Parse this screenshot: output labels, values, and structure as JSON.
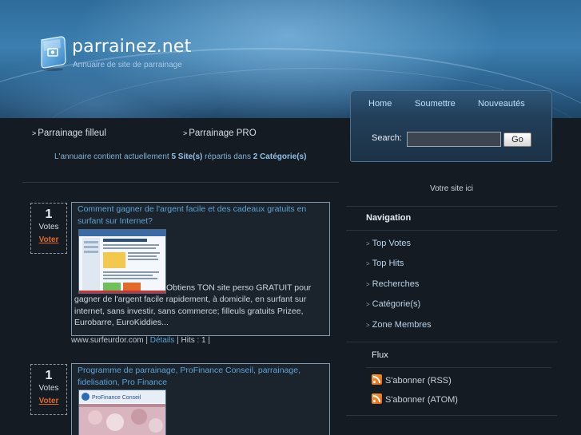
{
  "header": {
    "title": "parrainez.net",
    "subtitle": "Annuaire de site de parrainage"
  },
  "topnav": {
    "items": [
      "Home",
      "Soumettre",
      "Nouveautés"
    ],
    "search_label": "Search:",
    "search_value": "",
    "go_label": "Go"
  },
  "categories": [
    {
      "label": "Parrainage filleul"
    },
    {
      "label": "Parrainage PRO"
    }
  ],
  "count_line": {
    "prefix": "L'annuaire contient actuellement",
    "sites": "5 Site(s)",
    "middle": "répartis dans",
    "cats": "2 Catégorie(s)"
  },
  "listings": [
    {
      "votes": "1",
      "votes_label": "Votes",
      "vote_link": "Voter",
      "title": "Comment gagner de l'argent facile et des cadeaux gratuits en surfant sur Internet?",
      "desc_head": "Obtiens TON site perso GRATUIT pour",
      "desc_rest": "gagner de l'argent facile rapidement, à domicile, en surfant sur internet, sans investir, sans commerce; filleuls gratuits Prizee, Eurobarre, EuroKiddies...",
      "url": "www.surfeurdor.com",
      "sep1": "|",
      "details": "Détails",
      "hits": "| Hits : 1 |"
    },
    {
      "votes": "1",
      "votes_label": "Votes",
      "vote_link": "Voter",
      "title": "Programme de parrainage, ProFinance Conseil, parrainage, fidelisation, Pro Finance",
      "thumb_caption": "ProFinance Conseil"
    }
  ],
  "sidebar": {
    "banner": "Votre site ici",
    "nav_title": "Navigation",
    "nav_items": [
      "Top Votes",
      "Top Hits",
      "Recherches",
      "Catégorie(s)",
      "Zone Membres"
    ],
    "flux_title": "Flux",
    "feeds": [
      "S'abonner (RSS)",
      "S'abonner (ATOM)"
    ]
  },
  "colors": {
    "background": "#151b22",
    "link": "#5fa3d6",
    "vote_link": "#e06a2a",
    "header_blue": "#3b7fb0"
  },
  "icons": [
    "logo-icon",
    "bullet-arrow-icon",
    "rss-icon"
  ]
}
